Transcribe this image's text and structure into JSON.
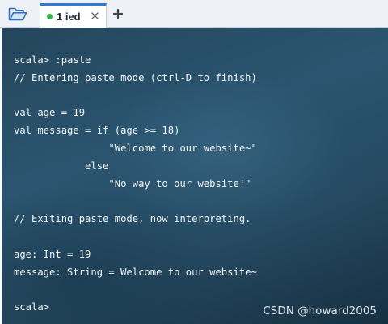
{
  "tabbar": {
    "open_icon": "folder-open-icon",
    "tab": {
      "label": "1 ied",
      "status_color": "#2fb64b",
      "close_icon": "close-icon"
    },
    "new_tab_icon": "plus-icon"
  },
  "terminal": {
    "lines": [
      "scala> :paste",
      "// Entering paste mode (ctrl-D to finish)",
      "",
      "val age = 19",
      "val message = if (age >= 18)",
      "                \"Welcome to our website~\"",
      "            else",
      "                \"No way to our website!\"",
      "",
      "// Exiting paste mode, now interpreting.",
      "",
      "age: Int = 19",
      "message: String = Welcome to our website~",
      "",
      "scala>"
    ],
    "watermark": "CSDN @howard2005"
  },
  "colors": {
    "accent": "#2e7bd6",
    "status_connected": "#2fb64b",
    "terminal_bg": "#2b5570",
    "terminal_text": "#f2f6f8"
  }
}
